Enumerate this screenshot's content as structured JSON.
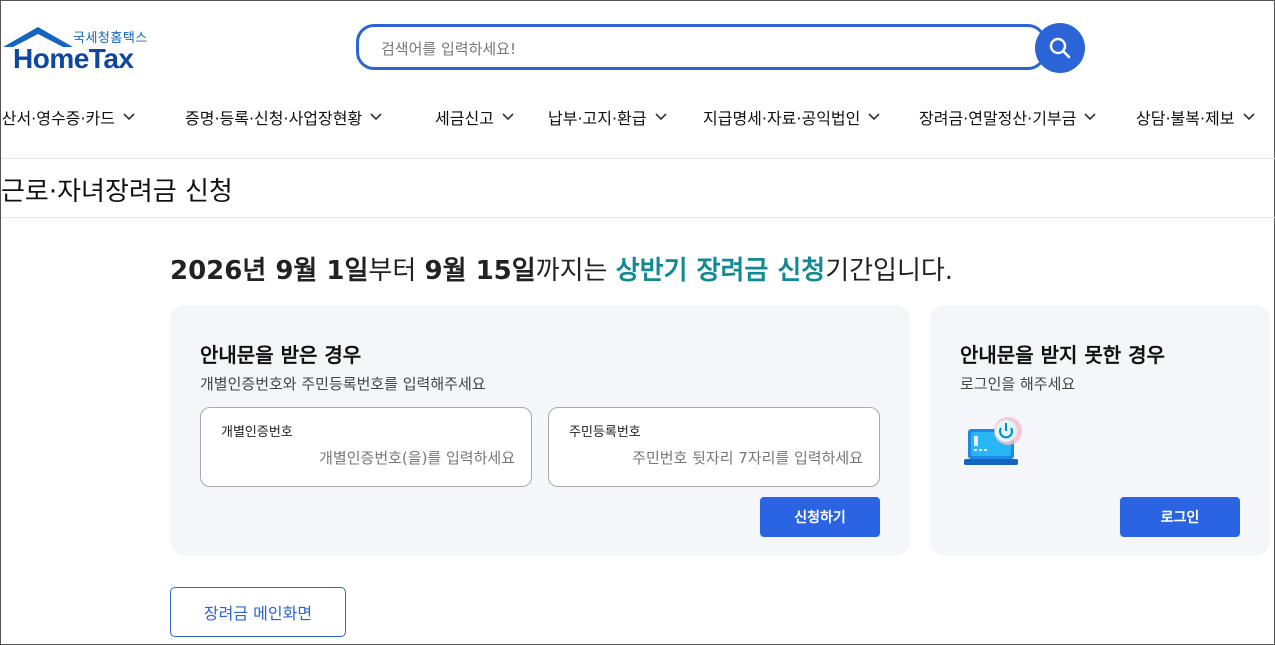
{
  "header": {
    "logo_kr": "국세청홈택스",
    "logo_en": "HomeTax",
    "search_placeholder": "검색어를 입력하세요!",
    "search_icon": "search-icon"
  },
  "nav": {
    "items": [
      {
        "label": "계산서·영수증·카드"
      },
      {
        "label": "증명·등록·신청·사업장현황"
      },
      {
        "label": "세금신고"
      },
      {
        "label": "납부·고지·환급"
      },
      {
        "label": "지급명세·자료·공익법인"
      },
      {
        "label": "장려금·연말정산·기부금"
      },
      {
        "label": "상담·불복·제보"
      }
    ]
  },
  "page_title": "근로·자녀장려금 신청",
  "period": {
    "start": "2026년 9월 1일",
    "from": "부터 ",
    "end": "9월 15일",
    "until": "까지는 ",
    "highlight": "상반기 장려금 신청",
    "tail": "기간입니다."
  },
  "card_notice": {
    "title": "안내문을 받은 경우",
    "subtitle": "개별인증번호와 주민등록번호를 입력해주세요",
    "field1_label": "개별인증번호",
    "field1_placeholder": "개별인증번호(을)를 입력하세요",
    "field2_label": "주민등록번호",
    "field2_placeholder": "주민번호 뒷자리 7자리를 입력하세요",
    "submit_label": "신청하기"
  },
  "card_login": {
    "title": "안내문을 받지 못한 경우",
    "subtitle": "로그인을 해주세요",
    "icon": "laptop-power-icon",
    "login_label": "로그인"
  },
  "main_button_label": "장려금 메인화면",
  "colors": {
    "primary": "#2b64e3",
    "teal_highlight": "#138a93",
    "card_bg": "#f5f6fa"
  }
}
